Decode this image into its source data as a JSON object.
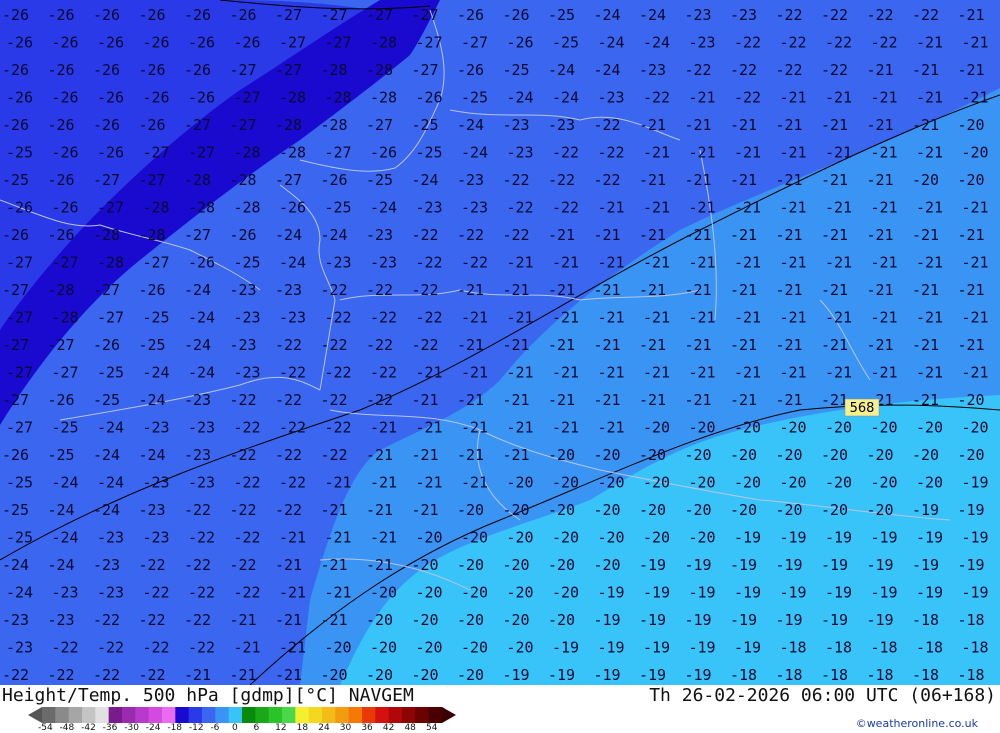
{
  "footer": {
    "title": "Height/Temp. 500 hPa [gdmp][°C] NAVGEM",
    "timestamp": "Th 26-02-2026 06:00 UTC (06+168)",
    "credit": "©weatheronline.co.uk"
  },
  "contour_label": "568",
  "legend": {
    "ticks": [
      "-54",
      "-48",
      "-42",
      "-36",
      "-30",
      "-24",
      "-18",
      "-12",
      "-6",
      "0",
      "6",
      "12",
      "18",
      "24",
      "30",
      "36",
      "42",
      "48",
      "54"
    ],
    "colors": [
      "#6b6b6b",
      "#8a8a8a",
      "#a6a6a6",
      "#c4c4c4",
      "#e0e0e0",
      "#7a1a8c",
      "#9a2ab0",
      "#b83acc",
      "#d44ae0",
      "#ec6af0",
      "#1a0ad0",
      "#2a3ae8",
      "#3a66f0",
      "#3a94f4",
      "#38c4f8",
      "#0a8a0a",
      "#1aa81a",
      "#2ac42a",
      "#4ad84a",
      "#f4f030",
      "#f4d820",
      "#f4bc18",
      "#f49c10",
      "#f47a08",
      "#e83a08",
      "#d41010",
      "#b00808",
      "#8c0404",
      "#6a0202",
      "#4a0000"
    ]
  },
  "temperatures": [
    [
      "-26",
      "-26",
      "-26",
      "-26",
      "-26",
      "-26",
      "-27",
      "-27",
      "-27",
      "-27",
      "-26",
      "-26",
      "-25",
      "-24",
      "-24",
      "-23",
      "-23",
      "-22",
      "-22",
      "-22",
      "-22",
      "-21"
    ],
    [
      "-26",
      "-26",
      "-26",
      "-26",
      "-26",
      "-26",
      "-27",
      "-27",
      "-28",
      "-27",
      "-27",
      "-26",
      "-25",
      "-24",
      "-24",
      "-23",
      "-22",
      "-22",
      "-22",
      "-22",
      "-21",
      "-21"
    ],
    [
      "-26",
      "-26",
      "-26",
      "-26",
      "-26",
      "-27",
      "-27",
      "-28",
      "-28",
      "-27",
      "-26",
      "-25",
      "-24",
      "-24",
      "-23",
      "-22",
      "-22",
      "-22",
      "-22",
      "-21",
      "-21",
      "-21"
    ],
    [
      "-26",
      "-26",
      "-26",
      "-26",
      "-26",
      "-27",
      "-28",
      "-28",
      "-28",
      "-26",
      "-25",
      "-24",
      "-24",
      "-23",
      "-22",
      "-21",
      "-22",
      "-21",
      "-21",
      "-21",
      "-21",
      "-21"
    ],
    [
      "-26",
      "-26",
      "-26",
      "-26",
      "-27",
      "-27",
      "-28",
      "-28",
      "-27",
      "-25",
      "-24",
      "-23",
      "-23",
      "-22",
      "-21",
      "-21",
      "-21",
      "-21",
      "-21",
      "-21",
      "-21",
      "-20"
    ],
    [
      "-25",
      "-26",
      "-26",
      "-27",
      "-27",
      "-28",
      "-28",
      "-27",
      "-26",
      "-25",
      "-24",
      "-23",
      "-22",
      "-22",
      "-21",
      "-21",
      "-21",
      "-21",
      "-21",
      "-21",
      "-21",
      "-20"
    ],
    [
      "-25",
      "-26",
      "-27",
      "-27",
      "-28",
      "-28",
      "-27",
      "-26",
      "-25",
      "-24",
      "-23",
      "-22",
      "-22",
      "-22",
      "-21",
      "-21",
      "-21",
      "-21",
      "-21",
      "-21",
      "-20",
      "-20"
    ],
    [
      "-26",
      "-26",
      "-27",
      "-28",
      "-28",
      "-28",
      "-26",
      "-25",
      "-24",
      "-23",
      "-23",
      "-22",
      "-22",
      "-21",
      "-21",
      "-21",
      "-21",
      "-21",
      "-21",
      "-21",
      "-21",
      "-21"
    ],
    [
      "-26",
      "-26",
      "-28",
      "-28",
      "-27",
      "-26",
      "-24",
      "-24",
      "-23",
      "-22",
      "-22",
      "-22",
      "-21",
      "-21",
      "-21",
      "-21",
      "-21",
      "-21",
      "-21",
      "-21",
      "-21",
      "-21"
    ],
    [
      "-27",
      "-27",
      "-28",
      "-27",
      "-26",
      "-25",
      "-24",
      "-23",
      "-23",
      "-22",
      "-22",
      "-21",
      "-21",
      "-21",
      "-21",
      "-21",
      "-21",
      "-21",
      "-21",
      "-21",
      "-21",
      "-21"
    ],
    [
      "-27",
      "-28",
      "-27",
      "-26",
      "-24",
      "-23",
      "-23",
      "-22",
      "-22",
      "-22",
      "-21",
      "-21",
      "-21",
      "-21",
      "-21",
      "-21",
      "-21",
      "-21",
      "-21",
      "-21",
      "-21",
      "-21"
    ],
    [
      "-27",
      "-28",
      "-27",
      "-25",
      "-24",
      "-23",
      "-23",
      "-22",
      "-22",
      "-22",
      "-21",
      "-21",
      "-21",
      "-21",
      "-21",
      "-21",
      "-21",
      "-21",
      "-21",
      "-21",
      "-21",
      "-21"
    ],
    [
      "-27",
      "-27",
      "-26",
      "-25",
      "-24",
      "-23",
      "-22",
      "-22",
      "-22",
      "-22",
      "-21",
      "-21",
      "-21",
      "-21",
      "-21",
      "-21",
      "-21",
      "-21",
      "-21",
      "-21",
      "-21",
      "-21"
    ],
    [
      "-27",
      "-27",
      "-25",
      "-24",
      "-24",
      "-23",
      "-22",
      "-22",
      "-22",
      "-21",
      "-21",
      "-21",
      "-21",
      "-21",
      "-21",
      "-21",
      "-21",
      "-21",
      "-21",
      "-21",
      "-21",
      "-21"
    ],
    [
      "-27",
      "-26",
      "-25",
      "-24",
      "-23",
      "-22",
      "-22",
      "-22",
      "-22",
      "-21",
      "-21",
      "-21",
      "-21",
      "-21",
      "-21",
      "-21",
      "-21",
      "-21",
      "-21",
      "-21",
      "-21",
      "-20"
    ],
    [
      "-27",
      "-25",
      "-24",
      "-23",
      "-23",
      "-22",
      "-22",
      "-22",
      "-21",
      "-21",
      "-21",
      "-21",
      "-21",
      "-21",
      "-20",
      "-20",
      "-20",
      "-20",
      "-20",
      "-20",
      "-20",
      "-20"
    ],
    [
      "-26",
      "-25",
      "-24",
      "-24",
      "-23",
      "-22",
      "-22",
      "-22",
      "-21",
      "-21",
      "-21",
      "-21",
      "-20",
      "-20",
      "-20",
      "-20",
      "-20",
      "-20",
      "-20",
      "-20",
      "-20",
      "-20"
    ],
    [
      "-25",
      "-24",
      "-24",
      "-23",
      "-23",
      "-22",
      "-22",
      "-21",
      "-21",
      "-21",
      "-21",
      "-20",
      "-20",
      "-20",
      "-20",
      "-20",
      "-20",
      "-20",
      "-20",
      "-20",
      "-20",
      "-19"
    ],
    [
      "-25",
      "-24",
      "-24",
      "-23",
      "-22",
      "-22",
      "-22",
      "-21",
      "-21",
      "-21",
      "-20",
      "-20",
      "-20",
      "-20",
      "-20",
      "-20",
      "-20",
      "-20",
      "-20",
      "-20",
      "-19",
      "-19"
    ],
    [
      "-25",
      "-24",
      "-23",
      "-23",
      "-22",
      "-22",
      "-21",
      "-21",
      "-21",
      "-20",
      "-20",
      "-20",
      "-20",
      "-20",
      "-20",
      "-20",
      "-19",
      "-19",
      "-19",
      "-19",
      "-19",
      "-19"
    ],
    [
      "-24",
      "-24",
      "-23",
      "-22",
      "-22",
      "-22",
      "-21",
      "-21",
      "-21",
      "-20",
      "-20",
      "-20",
      "-20",
      "-20",
      "-19",
      "-19",
      "-19",
      "-19",
      "-19",
      "-19",
      "-19",
      "-19"
    ],
    [
      "-24",
      "-23",
      "-23",
      "-22",
      "-22",
      "-22",
      "-21",
      "-21",
      "-20",
      "-20",
      "-20",
      "-20",
      "-20",
      "-19",
      "-19",
      "-19",
      "-19",
      "-19",
      "-19",
      "-19",
      "-19",
      "-19"
    ],
    [
      "-23",
      "-23",
      "-22",
      "-22",
      "-22",
      "-21",
      "-21",
      "-21",
      "-20",
      "-20",
      "-20",
      "-20",
      "-20",
      "-19",
      "-19",
      "-19",
      "-19",
      "-19",
      "-19",
      "-19",
      "-18",
      "-18"
    ],
    [
      "-23",
      "-22",
      "-22",
      "-22",
      "-22",
      "-21",
      "-21",
      "-20",
      "-20",
      "-20",
      "-20",
      "-20",
      "-19",
      "-19",
      "-19",
      "-19",
      "-19",
      "-18",
      "-18",
      "-18",
      "-18",
      "-18"
    ],
    [
      "-22",
      "-22",
      "-22",
      "-22",
      "-21",
      "-21",
      "-21",
      "-20",
      "-20",
      "-20",
      "-20",
      "-19",
      "-19",
      "-19",
      "-19",
      "-19",
      "-18",
      "-18",
      "-18",
      "-18",
      "-18",
      "-18"
    ]
  ]
}
